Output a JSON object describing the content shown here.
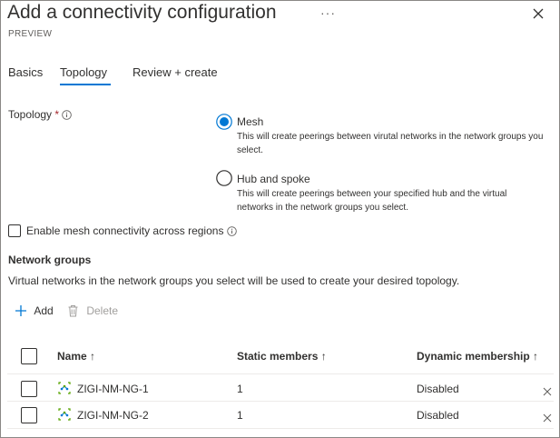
{
  "header": {
    "title": "Add a connectivity configuration",
    "subtitle": "PREVIEW",
    "more_label": "···"
  },
  "tabs": [
    {
      "label": "Basics",
      "active": false
    },
    {
      "label": "Topology",
      "active": true
    },
    {
      "label": "Review + create",
      "active": false
    }
  ],
  "topology": {
    "label": "Topology",
    "required_mark": "*",
    "options": [
      {
        "label": "Mesh",
        "selected": true,
        "description": "This will create peerings between virutal networks in the network groups you select."
      },
      {
        "label": "Hub and spoke",
        "selected": false,
        "description": "This will create peerings between your specified hub and the virtual networks in the network groups you select."
      }
    ]
  },
  "mesh_checkbox": {
    "label": "Enable mesh connectivity across regions",
    "checked": false
  },
  "network_groups": {
    "title": "Network groups",
    "description": "Virtual networks in the network groups you select will be used to create your desired topology.",
    "toolbar": {
      "add_label": "Add",
      "delete_label": "Delete"
    },
    "columns": [
      "Name ↑",
      "Static members ↑",
      "Dynamic membership ↑"
    ],
    "rows": [
      {
        "name": "ZIGI-NM-NG-1",
        "static_members": "1",
        "dynamic_membership": "Disabled"
      },
      {
        "name": "ZIGI-NM-NG-2",
        "static_members": "1",
        "dynamic_membership": "Disabled"
      }
    ]
  },
  "colors": {
    "accent": "#0078d4",
    "text": "#323130",
    "muted": "#605e5c",
    "disabled": "#a19f9d"
  }
}
